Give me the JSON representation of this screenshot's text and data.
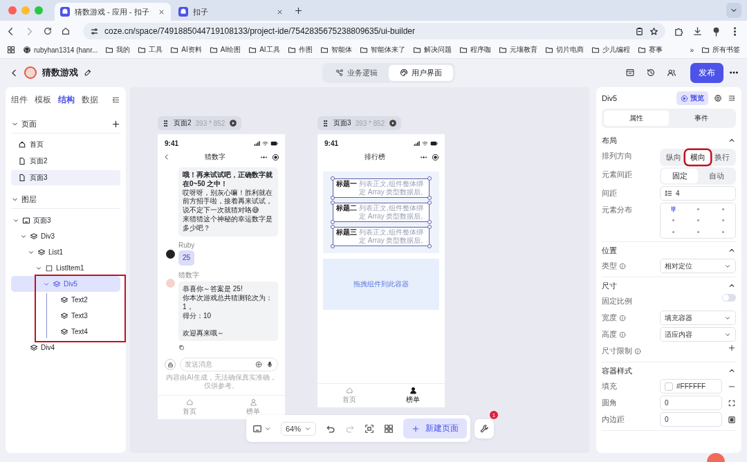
{
  "browser": {
    "tabs": [
      {
        "title": "猜数游戏 - 应用 - 扣子",
        "selected": true
      },
      {
        "title": "扣子",
        "selected": false
      }
    ],
    "url": "coze.cn/space/7491885044719108133/project-ide/7542835675238809635/ui-builder",
    "bookmarks": [
      {
        "kind": "github",
        "label": "rubyhan1314 (hanr..."
      },
      {
        "kind": "folder",
        "label": "我的"
      },
      {
        "kind": "folder",
        "label": "工具"
      },
      {
        "kind": "folder",
        "label": "AI资料"
      },
      {
        "kind": "folder",
        "label": "AI绘图"
      },
      {
        "kind": "folder",
        "label": "AI工具"
      },
      {
        "kind": "folder",
        "label": "作图"
      },
      {
        "kind": "folder",
        "label": "智能体"
      },
      {
        "kind": "folder",
        "label": "智能体来了"
      },
      {
        "kind": "folder",
        "label": "解决问题"
      },
      {
        "kind": "folder",
        "label": "程序咖"
      },
      {
        "kind": "folder",
        "label": "元壤教育"
      },
      {
        "kind": "folder",
        "label": "切片电商"
      },
      {
        "kind": "folder",
        "label": "少儿编程"
      },
      {
        "kind": "folder",
        "label": "赛事"
      }
    ],
    "overflow": "»",
    "all_bookmarks": "所有书签"
  },
  "app_header": {
    "title": "猜数游戏",
    "modes": [
      {
        "label": "业务逻辑",
        "kind": "flow",
        "selected": false
      },
      {
        "label": "用户界面",
        "kind": "palette",
        "selected": true
      }
    ],
    "publish": "发布"
  },
  "left_panel": {
    "tabs": [
      {
        "label": "组件",
        "selected": false
      },
      {
        "label": "模板",
        "selected": false
      },
      {
        "label": "结构",
        "selected": true
      },
      {
        "label": "数据",
        "selected": false
      }
    ],
    "pages": {
      "title": "页面",
      "expanded": true,
      "items": [
        {
          "label": "首页",
          "kind": "home",
          "selected": false
        },
        {
          "label": "页面2",
          "kind": "page",
          "selected": false
        },
        {
          "label": "页面3",
          "kind": "page",
          "selected": true
        }
      ]
    },
    "layers": {
      "title": "图层",
      "expanded": true,
      "tree": [
        {
          "label": "页面3",
          "kind": "screen",
          "expanded": true,
          "selected": false,
          "children": [
            {
              "label": "Div3",
              "kind": "layer",
              "expanded": true,
              "selected": false,
              "children": [
                {
                  "label": "List1",
                  "kind": "layer",
                  "expanded": true,
                  "selected": false,
                  "children": [
                    {
                      "label": "ListItem1",
                      "kind": "listitem",
                      "expanded": true,
                      "selected": false,
                      "children": [
                        {
                          "label": "Div5",
                          "kind": "layer",
                          "expanded": true,
                          "selected": true,
                          "annotated": true,
                          "children": [
                            {
                              "label": "Text2",
                              "kind": "layer",
                              "selected": false
                            },
                            {
                              "label": "Text3",
                              "kind": "layer",
                              "selected": false
                            },
                            {
                              "label": "Text4",
                              "kind": "layer",
                              "selected": false
                            }
                          ]
                        }
                      ]
                    }
                  ]
                }
              ]
            },
            {
              "label": "Div4",
              "kind": "layer",
              "selected": false
            }
          ]
        }
      ]
    }
  },
  "canvas": {
    "pages": [
      {
        "name": "页面2",
        "size": "393 * 852",
        "phone": {
          "kind": "chat",
          "time": "9:41",
          "title": "猜数字",
          "back": true,
          "messages": [
            {
              "kind": "bot",
              "lines": [
                {
                  "text": "哦！再来试试吧，正确数字就在0~50 之中！",
                  "bold": true
                },
                {
                  "text": "哎呀呀，别灰心嘛！胜利就在前方招手啦，接着再来试试，说不定下一次就猜对咯😅"
                },
                {
                  "text": "来猜猜这个神秘的幸运数字是多少吧？"
                }
              ]
            },
            {
              "kind": "user",
              "sender": "Ruby",
              "lines": [
                {
                  "text": "25"
                }
              ]
            },
            {
              "kind": "bot",
              "sender": "猜数字",
              "lines": [
                {
                  "text": "恭喜你～答案是 25!"
                },
                {
                  "text": "你本次游戏总共猜测轮次为：1，"
                },
                {
                  "text": "得分：10"
                },
                {
                  "text": "欢迎再来哦～",
                  "spaced": true
                }
              ],
              "copy": true
            }
          ],
          "input_placeholder": "发送消息",
          "disclaimer": "内容由AI生成，无法确保真实准确，仅供参考。",
          "tabbar": [
            {
              "label": "首页",
              "kind": "home",
              "selected": false
            },
            {
              "label": "榜单",
              "kind": "person",
              "selected": false
            }
          ]
        }
      },
      {
        "name": "页面3",
        "size": "393 * 852",
        "phone": {
          "kind": "list",
          "time": "9:41",
          "title": "排行榜",
          "back": false,
          "list_items": [
            {
              "title": "标题一",
              "text": "列表正文,组件整体绑定 Array 类型数据后,"
            },
            {
              "title": "标题二",
              "text": "列表正文,组件整体绑定 Array 类型数据后,"
            },
            {
              "title": "标题三",
              "text": "列表正文,组件整体绑定 Array 类型数据后,"
            }
          ],
          "dropzone": "拖拽组件到此容器",
          "tabbar": [
            {
              "label": "首页",
              "kind": "home",
              "selected": false
            },
            {
              "label": "榜单",
              "kind": "person",
              "selected": true
            }
          ]
        }
      }
    ],
    "toolbar": {
      "zoom": "64%",
      "undo": {
        "disabled": false
      },
      "redo": {
        "disabled": true
      },
      "new_page": "新建页面",
      "badge": "1"
    }
  },
  "right_panel": {
    "title": "Div5",
    "preview": "预览",
    "tabs": [
      {
        "label": "属性",
        "selected": true
      },
      {
        "label": "事件",
        "selected": false
      }
    ],
    "sections": [
      {
        "title": "布局",
        "expanded": true,
        "rows": [
          {
            "label": "排列方向",
            "kind": "segmented",
            "options": [
              {
                "label": "纵向",
                "selected": false
              },
              {
                "label": "横向",
                "selected": true,
                "annotated": true
              },
              {
                "label": "换行",
                "selected": false
              }
            ]
          },
          {
            "label": "元素间距",
            "kind": "segmented",
            "options": [
              {
                "label": "固定",
                "selected": true
              },
              {
                "label": "自动",
                "selected": false
              }
            ]
          },
          {
            "label": "间距",
            "kind": "number",
            "value": "4"
          },
          {
            "label": "元素分布",
            "kind": "align_grid",
            "cells": [
              {
                "selected": true
              },
              {
                "selected": false
              },
              {
                "selected": false
              },
              {
                "selected": false
              },
              {
                "selected": false
              },
              {
                "selected": false
              },
              {
                "selected": false
              },
              {
                "selected": false
              },
              {
                "selected": false
              }
            ]
          }
        ]
      },
      {
        "title": "位置",
        "expanded": true,
        "rows": [
          {
            "label": "类型",
            "info": true,
            "kind": "select",
            "value": "相对定位"
          }
        ]
      },
      {
        "title": "尺寸",
        "expanded": true,
        "rows": [
          {
            "label": "固定比例",
            "kind": "toggle",
            "on": false
          },
          {
            "label": "宽度",
            "info": true,
            "kind": "select",
            "value": "填充容器"
          },
          {
            "label": "高度",
            "info": true,
            "kind": "select",
            "value": "适应内容"
          },
          {
            "label": "尺寸限制",
            "info": true,
            "kind": "add"
          }
        ]
      },
      {
        "title": "容器样式",
        "expanded": true,
        "rows": [
          {
            "label": "填充",
            "kind": "color",
            "value": "#FFFFFF"
          },
          {
            "label": "圆角",
            "kind": "corner_input",
            "value": "0"
          },
          {
            "label": "内边距",
            "kind": "padding_input",
            "value": "0"
          }
        ]
      }
    ]
  }
}
